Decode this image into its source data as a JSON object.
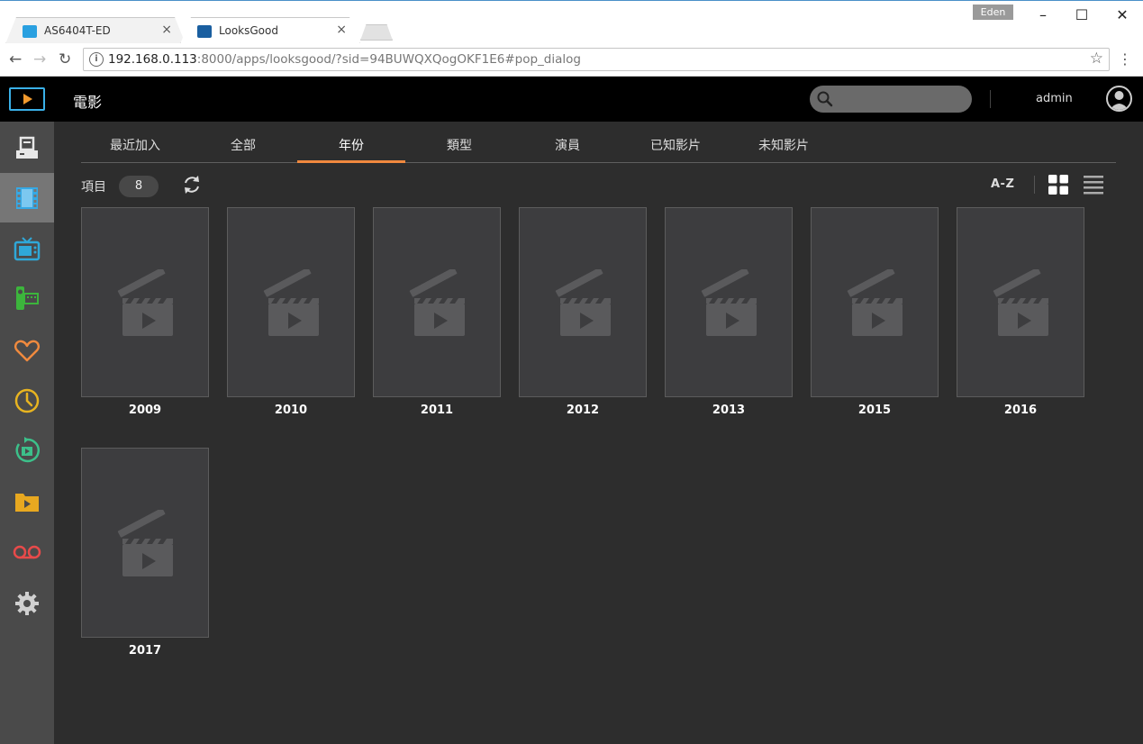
{
  "browser": {
    "tabs": [
      {
        "title": "AS6404T-ED",
        "favicon_color": "#2aa0e0"
      },
      {
        "title": "LooksGood",
        "favicon_color": "#1a5fa0"
      }
    ],
    "close_glyph": "×",
    "profile": "Eden",
    "url_host": "192.168.0.113",
    "url_rest": ":8000/apps/looksgood/?sid=94BUWQXQogOKF1E6#pop_dialog",
    "window_controls": {
      "minimize": "–",
      "maximize": "☐",
      "close": "✕"
    },
    "nav": {
      "back": "←",
      "forward": "→",
      "reload": "↻"
    },
    "bookmark_glyph": "☆",
    "menu_glyph": "⋮",
    "info_glyph": "i"
  },
  "app": {
    "title": "電影",
    "search_placeholder": "",
    "username": "admin"
  },
  "sidebar": {
    "items": [
      {
        "name": "sidebar-item-server",
        "icon": "server-icon",
        "color": "#e8e8e8"
      },
      {
        "name": "sidebar-item-movies",
        "icon": "film-icon",
        "color": "#35a9e6",
        "active": true
      },
      {
        "name": "sidebar-item-tv",
        "icon": "tv-icon",
        "color": "#2fa8d8"
      },
      {
        "name": "sidebar-item-videos",
        "icon": "camcorder-icon",
        "color": "#3cb53c"
      },
      {
        "name": "sidebar-item-favorites",
        "icon": "heart-icon",
        "color": "#f08a3e"
      },
      {
        "name": "sidebar-item-recent",
        "icon": "clock-icon",
        "color": "#e8b420"
      },
      {
        "name": "sidebar-item-recently-played",
        "icon": "replay-icon",
        "color": "#3cc08a"
      },
      {
        "name": "sidebar-item-folders",
        "icon": "folder-icon",
        "color": "#e8a820"
      },
      {
        "name": "sidebar-item-recordings",
        "icon": "recording-icon",
        "color": "#e84a4a"
      },
      {
        "name": "sidebar-item-settings",
        "icon": "gear-icon",
        "color": "#d0d0d0"
      }
    ]
  },
  "category_tabs": [
    {
      "label": "最近加入"
    },
    {
      "label": "全部"
    },
    {
      "label": "年份",
      "active": true
    },
    {
      "label": "類型"
    },
    {
      "label": "演員"
    },
    {
      "label": "已知影片"
    },
    {
      "label": "未知影片"
    }
  ],
  "toolbar": {
    "count_label": "項目",
    "count": "8",
    "sort_label": "A-Z"
  },
  "items": [
    {
      "label": "2009"
    },
    {
      "label": "2010"
    },
    {
      "label": "2011"
    },
    {
      "label": "2012"
    },
    {
      "label": "2013"
    },
    {
      "label": "2015"
    },
    {
      "label": "2016"
    },
    {
      "label": "2017"
    }
  ],
  "colors": {
    "accent": "#f0883e",
    "header_bg": "#000000",
    "sidebar_bg": "#4a4a4a",
    "content_bg": "#2d2d2d"
  }
}
